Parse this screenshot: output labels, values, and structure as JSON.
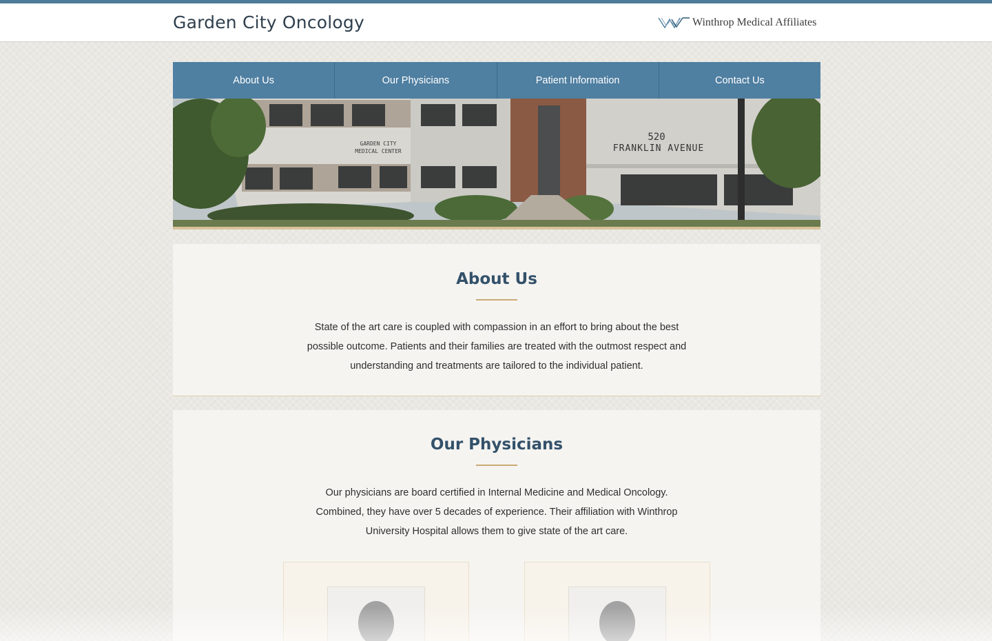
{
  "header": {
    "site_title": "Garden City Oncology",
    "affiliate_name": "Winthrop Medical Affiliates",
    "affiliate_logo_icon": "winthrop-logo-icon"
  },
  "nav": {
    "items": [
      {
        "label": "About Us"
      },
      {
        "label": "Our Physicians"
      },
      {
        "label": "Patient Information"
      },
      {
        "label": "Contact Us"
      }
    ]
  },
  "hero": {
    "sign_left_line1": "GARDEN CITY",
    "sign_left_line2": "MEDICAL CENTER",
    "sign_number": "520",
    "sign_street": "FRANKLIN AVENUE"
  },
  "about": {
    "title": "About Us",
    "text": "State of the art care is coupled with compassion in an effort to bring about the best possible outcome. Patients and their families are treated with the outmost respect and understanding and treatments are tailored to the individual patient."
  },
  "physicians": {
    "title": "Our Physicians",
    "text": "Our physicians are board certified in Internal Medicine and Medical Oncology. Combined, they have over 5 decades of experience. Their affiliation with Winthrop University Hospital allows them to give state of the art care.",
    "cards": [
      {
        "photo_icon": "avatar-placeholder-icon"
      },
      {
        "photo_icon": "avatar-placeholder-icon"
      }
    ]
  },
  "colors": {
    "accent": "#4f7fa1",
    "gold": "#c9ab74",
    "title_text": "#34516a"
  }
}
